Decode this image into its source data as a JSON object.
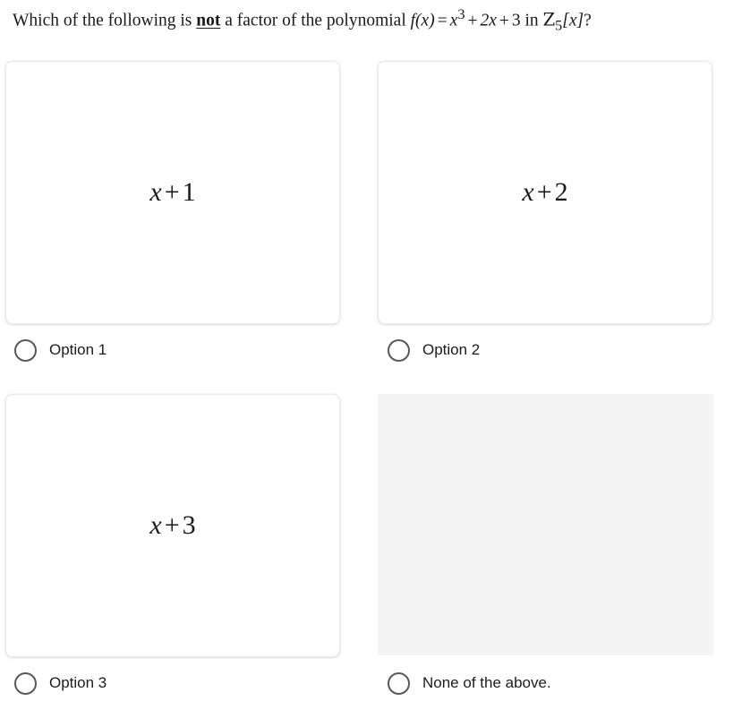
{
  "question": {
    "prefix": "Which of the following is ",
    "emphasis": "not",
    "middle": " a factor of the polynomial ",
    "function_name": "f",
    "function_arg": "(x)",
    "equals": "=",
    "term1_base": "x",
    "term1_exp": "3",
    "plus1": "+",
    "term2": "2x",
    "plus2": "+",
    "term3": "3",
    "connector": "in",
    "ring_symbol": "Z",
    "ring_subscript": "5",
    "ring_bracket": "[x]",
    "terminator": "?",
    "full_text": "Which of the following is not a factor of the polynomial f(x) = x^3 + 2x + 3 in Z_5[x]?"
  },
  "options": [
    {
      "id": "option-1",
      "expression_var": "x",
      "expression_op": "+",
      "expression_const": "1",
      "expression_text": "x + 1",
      "label": "Option 1",
      "has_card_content": true,
      "selected": false
    },
    {
      "id": "option-2",
      "expression_var": "x",
      "expression_op": "+",
      "expression_const": "2",
      "expression_text": "x + 2",
      "label": "Option 2",
      "has_card_content": true,
      "selected": false
    },
    {
      "id": "option-3",
      "expression_var": "x",
      "expression_op": "+",
      "expression_const": "3",
      "expression_text": "x + 3",
      "label": "Option 3",
      "has_card_content": true,
      "selected": false
    },
    {
      "id": "option-4",
      "expression_var": "",
      "expression_op": "",
      "expression_const": "",
      "expression_text": "",
      "label": "None of the above.",
      "has_card_content": false,
      "selected": false
    }
  ],
  "colors": {
    "page_background": "#ffffff",
    "card_background": "#ffffff",
    "card_border": "#e9e9e9",
    "placeholder_background": "#f4f4f4",
    "radio_border": "#56595c",
    "text": "#1a1a1a",
    "label_text": "#1c1c1c"
  }
}
